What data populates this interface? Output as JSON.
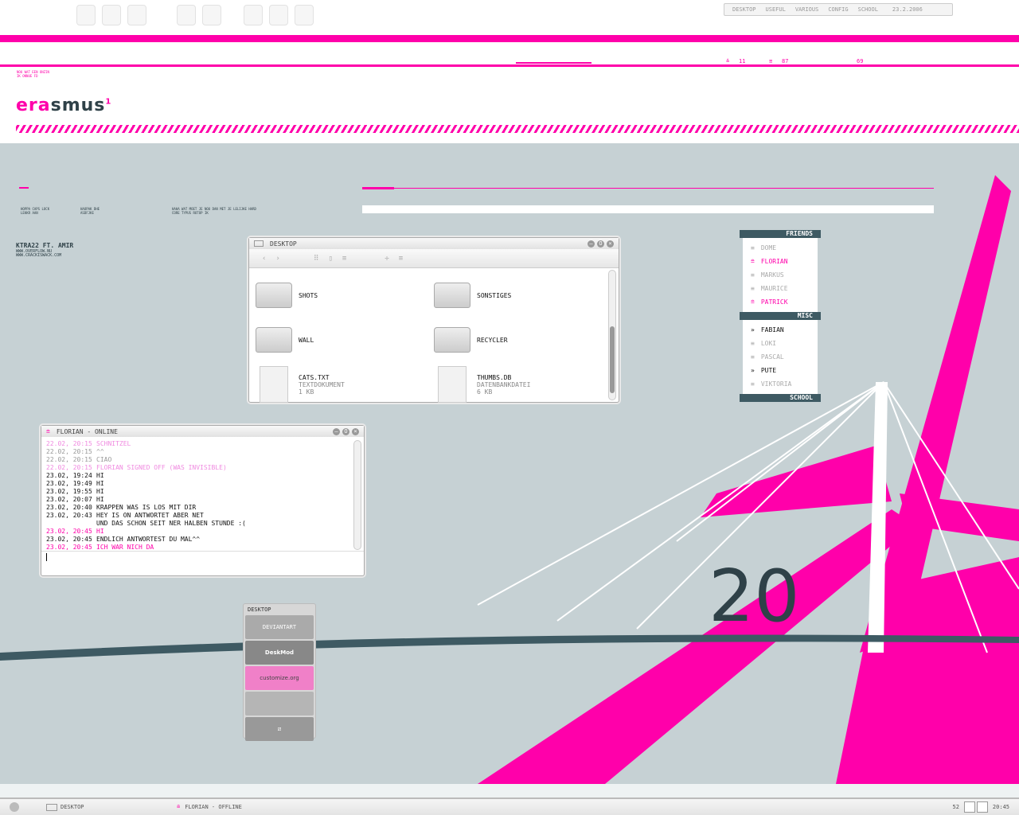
{
  "colors": {
    "accent": "#ff00aa",
    "dark": "#3e5a63",
    "bg": "#c6d1d4"
  },
  "dock": {
    "icons": [
      "x-icon",
      "map-icon",
      "ipod-icon",
      "drive-icon",
      "can-icon",
      "cd-icon",
      "gear-icon",
      "pin-icon"
    ]
  },
  "nav": {
    "items": [
      "Desktop",
      "Useful",
      "Various",
      "Config",
      "School"
    ],
    "date": "23.2.2006"
  },
  "stats": {
    "up": "11",
    "down": "87",
    "temp": "69"
  },
  "header": {
    "logo_pink": "era",
    "logo_dark": "smus",
    "logo_sup": "1",
    "tagline": "NOU WAT EEN ONZIN IK ONNUE FD"
  },
  "notes": [
    "HOPPA CAPS LOCK LEKKR AAN",
    "HAOPAK DHE ASDFJKE",
    "HAHA WAT MOET JE NOU DAN MET JE LELIJKE HARD CORE TYPUS ROTOP IK"
  ],
  "credit": {
    "title": "KTRA22 FT. AMIR",
    "line1": "WWW.OVERFLOW.NU",
    "line2": "WWW.CRACKISWACK.COM"
  },
  "explorer": {
    "title": "Desktop",
    "items": [
      {
        "name": "Shots",
        "kind": "folder"
      },
      {
        "name": "Sonstiges",
        "kind": "folder"
      },
      {
        "name": "Wall",
        "kind": "folder"
      },
      {
        "name": "Recycler",
        "kind": "folder"
      },
      {
        "name": "cats.txt",
        "kind": "doc",
        "type": "Textdokument",
        "size": "1 KB"
      },
      {
        "name": "Thumbs.db",
        "kind": "doc",
        "type": "Datenbankdatei",
        "size": "6 KB"
      }
    ]
  },
  "chat": {
    "title": "Florian - online",
    "input": "",
    "lines": [
      {
        "t": "22.02, 20:15",
        "m": "Schnitzel",
        "c": "lp"
      },
      {
        "t": "22.02, 20:15",
        "m": "^^",
        "c": "gray"
      },
      {
        "t": "22.02, 20:15",
        "m": "Ciao",
        "c": "gray"
      },
      {
        "t": "22.02, 20:15",
        "m": "Florian signed off (was invisible)",
        "c": "lp"
      },
      {
        "t": "23.02, 19:24",
        "m": "hi",
        "c": ""
      },
      {
        "t": "23.02, 19:49",
        "m": "hi",
        "c": ""
      },
      {
        "t": "23.02, 19:55",
        "m": "hi",
        "c": ""
      },
      {
        "t": "23.02, 20:07",
        "m": "hi",
        "c": ""
      },
      {
        "t": "23.02, 20:40",
        "m": "krappen was is los mit dir",
        "c": ""
      },
      {
        "t": "23.02, 20:43",
        "m": "hey is on antwortet aber net",
        "c": ""
      },
      {
        "t": "",
        "m": "und das schon seit ner halben stunde :(",
        "c": ""
      },
      {
        "t": "23.02, 20:45",
        "m": "hi",
        "c": "pk"
      },
      {
        "t": "23.02, 20:45",
        "m": "endlich antwortest du mal^^",
        "c": ""
      },
      {
        "t": "23.02, 20:45",
        "m": "ich war nich da",
        "c": "pk"
      }
    ]
  },
  "buddies": {
    "groups": [
      {
        "name": "Friends",
        "members": [
          {
            "n": "Dome",
            "s": "off"
          },
          {
            "n": "Florian",
            "s": "pink"
          },
          {
            "n": "Markus",
            "s": "off"
          },
          {
            "n": "Maurice",
            "s": "off"
          },
          {
            "n": "Patrick",
            "s": "pink"
          }
        ]
      },
      {
        "name": "Misc",
        "members": [
          {
            "n": "Fabian",
            "s": "on"
          },
          {
            "n": "Loki",
            "s": "off"
          },
          {
            "n": "Pascal",
            "s": "off"
          },
          {
            "n": "Pute",
            "s": "on"
          },
          {
            "n": "Viktoria",
            "s": "off"
          }
        ]
      },
      {
        "name": "School",
        "members": []
      }
    ]
  },
  "links": {
    "title": "Desktop",
    "items": [
      "DEVIANTART",
      "DeskMod",
      "customize.org",
      "",
      ""
    ]
  },
  "taskbar": {
    "tasks": [
      "Desktop",
      "Florian - offline"
    ],
    "count": "52",
    "clock": "20:45"
  }
}
